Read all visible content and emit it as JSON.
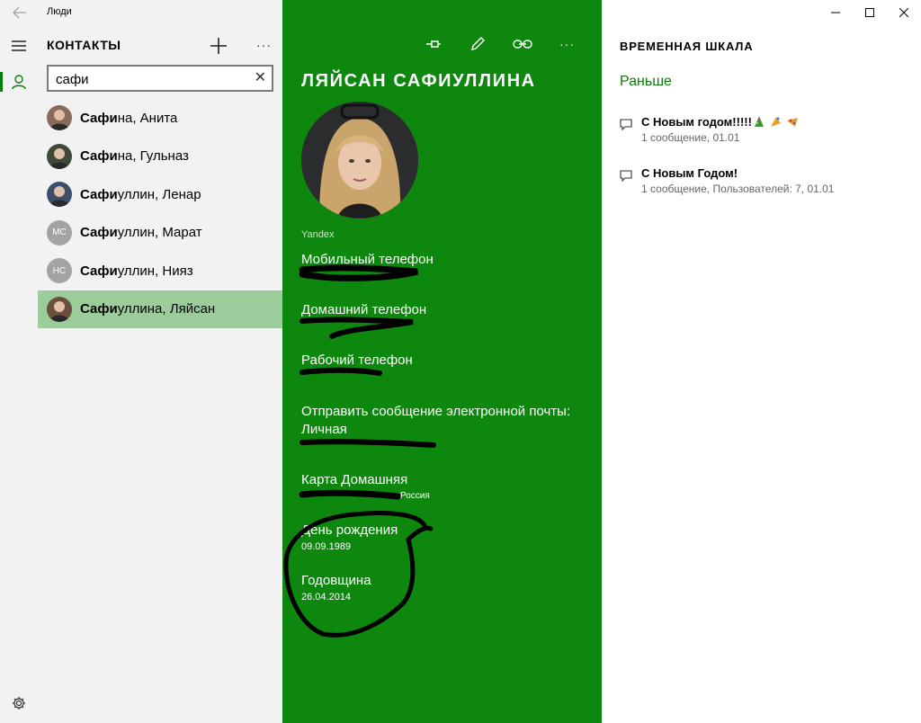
{
  "window": {
    "title": "Люди"
  },
  "contacts_pane": {
    "header": "КОНТАКТЫ",
    "search_value": "сафи",
    "search_query_bold": "Сафи",
    "items": [
      {
        "rest": "на, Анита",
        "initials": "",
        "selected": false,
        "avatar_color": "#8a6a5a"
      },
      {
        "rest": "на, Гульназ",
        "initials": "",
        "selected": false,
        "avatar_color": "#3f4a3a"
      },
      {
        "rest": "уллин, Ленар",
        "initials": "",
        "selected": false,
        "avatar_color": "#3c4f6a"
      },
      {
        "rest": "уллин, Марат",
        "initials": "МС",
        "selected": false,
        "avatar_color": "#a3a3a3"
      },
      {
        "rest": "уллин, Нияз",
        "initials": "НС",
        "selected": false,
        "avatar_color": "#a3a3a3"
      },
      {
        "rest": "уллина, Ляйсан",
        "initials": "",
        "selected": true,
        "avatar_color": "#6b5040"
      }
    ]
  },
  "detail": {
    "name": "ЛЯЙСАН САФИУЛЛИНА",
    "source": "Yandex",
    "fields": [
      {
        "label": "Мобильный телефон",
        "value": ""
      },
      {
        "label": "Домашний телефон",
        "value": ""
      },
      {
        "label": "Рабочий телефон",
        "value": ""
      },
      {
        "label": "Отправить сообщение электронной почты: Личная",
        "value": ""
      },
      {
        "label": "Карта Домашняя",
        "value": "Россия"
      },
      {
        "label": "День рождения",
        "value": "09.09.1989"
      },
      {
        "label": "Годовщина",
        "value": "26.04.2014"
      }
    ]
  },
  "timeline": {
    "header": "ВРЕМЕННАЯ ШКАЛА",
    "section": "Раньше",
    "items": [
      {
        "title": "С Новым годом!!!!!",
        "subtitle": "1 сообщение, 01.01"
      },
      {
        "title": "С Новым Годом!",
        "subtitle": "1 сообщение, Пользователей: 7, 01.01"
      }
    ]
  },
  "icons": {
    "back": "back-arrow-icon",
    "menu": "hamburger-icon",
    "contacts": "person-icon",
    "settings": "gear-icon",
    "add": "plus-icon",
    "pin": "pin-icon",
    "edit": "pencil-icon",
    "link": "link-icon",
    "message": "chat-bubble-icon",
    "minimize": "minimize-icon",
    "maximize": "maximize-icon",
    "close": "close-icon"
  },
  "colors": {
    "accent": "#0d870d",
    "selected_row": "#9ccc9c",
    "section_text": "#0a7c0a"
  }
}
